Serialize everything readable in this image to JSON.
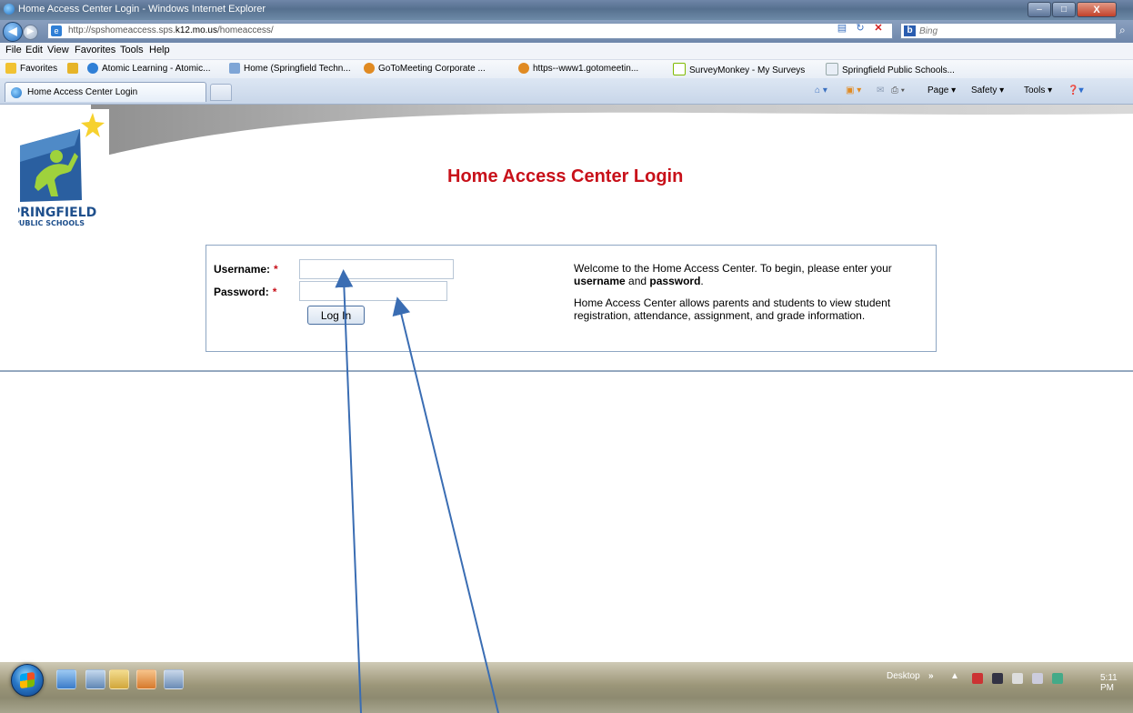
{
  "window": {
    "title": "Home Access Center Login - Windows Internet Explorer",
    "min_label": "‒",
    "max_label": "□",
    "close_label": "X"
  },
  "addressbar": {
    "url_prefix": "http://spshomeaccess.sps.",
    "url_domain": "k12.mo.us",
    "url_suffix": "/homeaccess/",
    "search_placeholder": "Bing"
  },
  "menubar": {
    "items": [
      "File",
      "Edit",
      "View",
      "Favorites",
      "Tools",
      "Help"
    ]
  },
  "favorites": {
    "label": "Favorites",
    "items": [
      "Atomic Learning - Atomic...",
      "Home (Springfield Techn...",
      "GoToMeeting Corporate ...",
      "https--www1.gotomeetin...",
      "SurveyMonkey - My Surveys",
      "Springfield Public Schools..."
    ]
  },
  "tabs": {
    "active": "Home Access Center Login"
  },
  "commandbar": {
    "items": [
      "Page ▾",
      "Safety ▾",
      "Tools ▾"
    ]
  },
  "logo": {
    "line1": "SPRINGFIELD",
    "line2": "PUBLIC SCHOOLS"
  },
  "page": {
    "title": "Home Access Center Login",
    "username_label": "Username:",
    "password_label": "Password:",
    "required_marker": "*",
    "login_button": "Log In",
    "welcome_pre": "Welcome to the Home Access Center. To begin, please enter your ",
    "welcome_username": "username",
    "welcome_and": " and ",
    "welcome_password": "password",
    "welcome_end": ".",
    "info": "Home Access Center allows parents and students to view student registration, attendance, assignment, and grade information."
  },
  "taskbar": {
    "desktop_label": "Desktop",
    "overflow_label": "»",
    "clock": "5:11 PM"
  },
  "colors": {
    "title_red": "#c8111a",
    "logo_blue": "#1e4f8c",
    "arrow_blue": "#3a6db3"
  }
}
